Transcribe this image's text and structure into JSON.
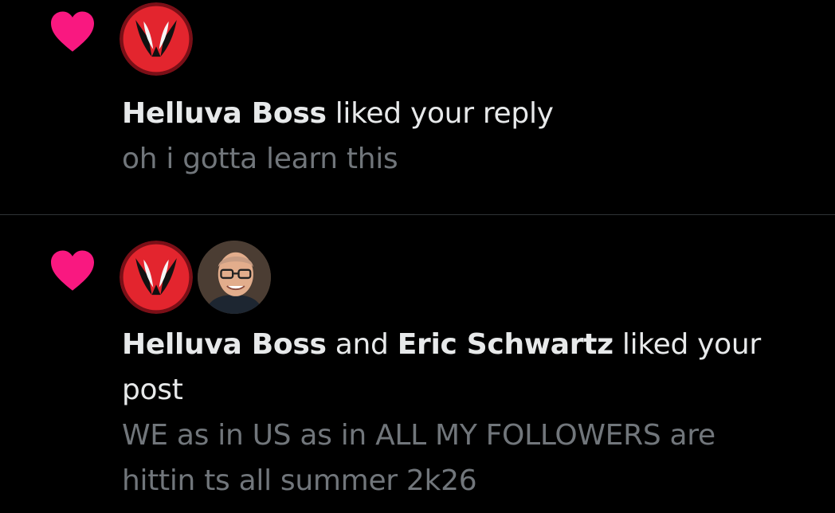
{
  "notifications": [
    {
      "type": "like",
      "icon": "heart-icon",
      "avatars": [
        "helluva-boss-avatar"
      ],
      "actors": [
        "Helluva Boss"
      ],
      "action": "liked your reply",
      "preview": "oh i gotta learn this"
    },
    {
      "type": "like",
      "icon": "heart-icon",
      "avatars": [
        "helluva-boss-avatar",
        "eric-schwartz-avatar"
      ],
      "actors": [
        "Helluva Boss",
        "Eric Schwartz"
      ],
      "joiner": "and",
      "action": "liked your post",
      "preview": "WE as in US as in ALL MY FOLLOWERS are hittin ts all summer 2k26"
    }
  ],
  "colors": {
    "background": "#000000",
    "heart": "#f91880",
    "primary_text": "#e7e9ea",
    "secondary_text": "#71767b",
    "divider": "#2f3336"
  }
}
